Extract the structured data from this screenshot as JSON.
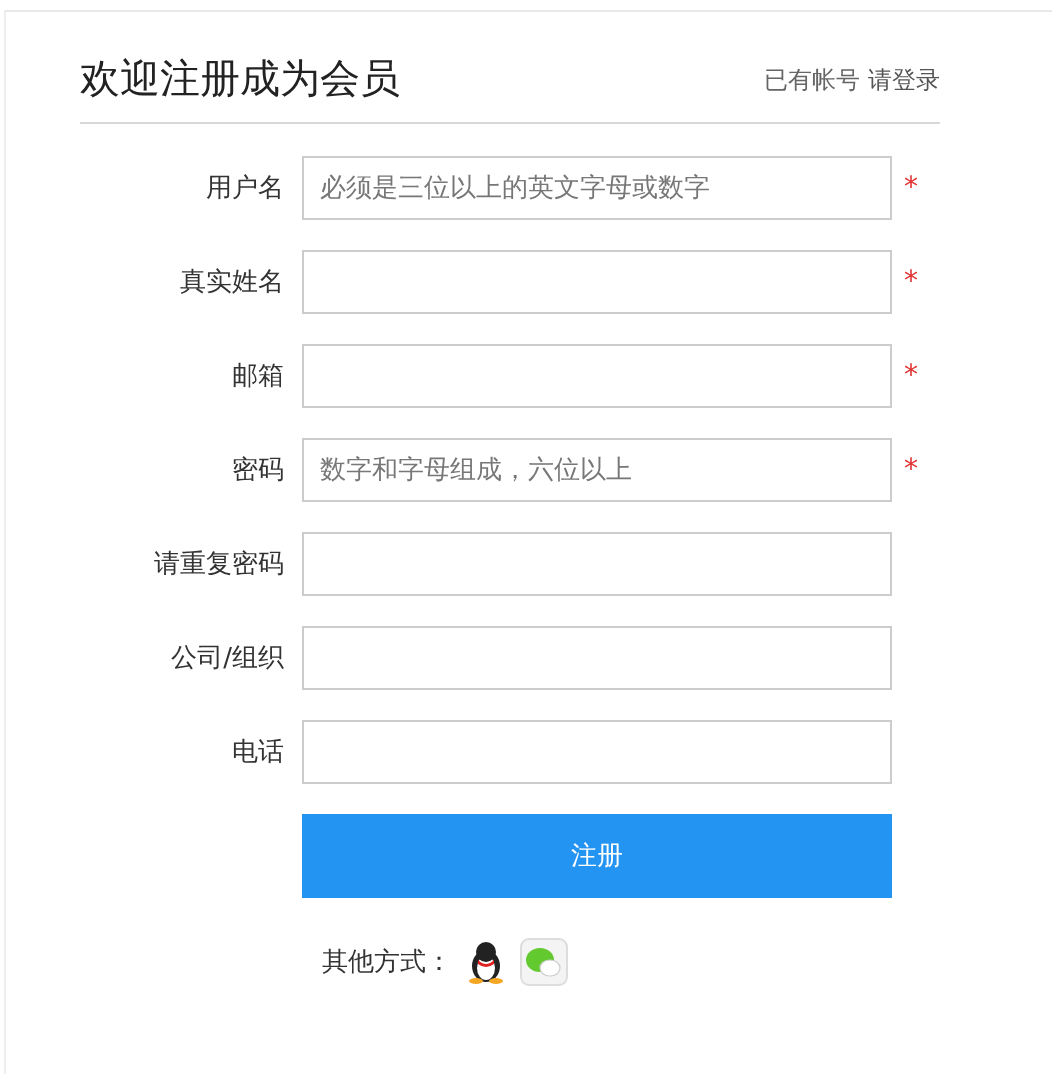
{
  "header": {
    "title": "欢迎注册成为会员",
    "login_prompt": "已有帐号",
    "login_link": "请登录"
  },
  "fields": [
    {
      "label": "用户名",
      "placeholder": "必须是三位以上的英文字母或数字",
      "required": true
    },
    {
      "label": "真实姓名",
      "required": true
    },
    {
      "label": "邮箱",
      "required": true
    },
    {
      "label": "密码",
      "placeholder": "数字和字母组成，六位以上",
      "required": true
    },
    {
      "label": "请重复密码",
      "required": false
    },
    {
      "label": "公司/组织",
      "required": false
    },
    {
      "label": "电话",
      "required": false
    }
  ],
  "required_mark": "*",
  "submit": "注册",
  "other_methods": {
    "label": "其他方式："
  }
}
